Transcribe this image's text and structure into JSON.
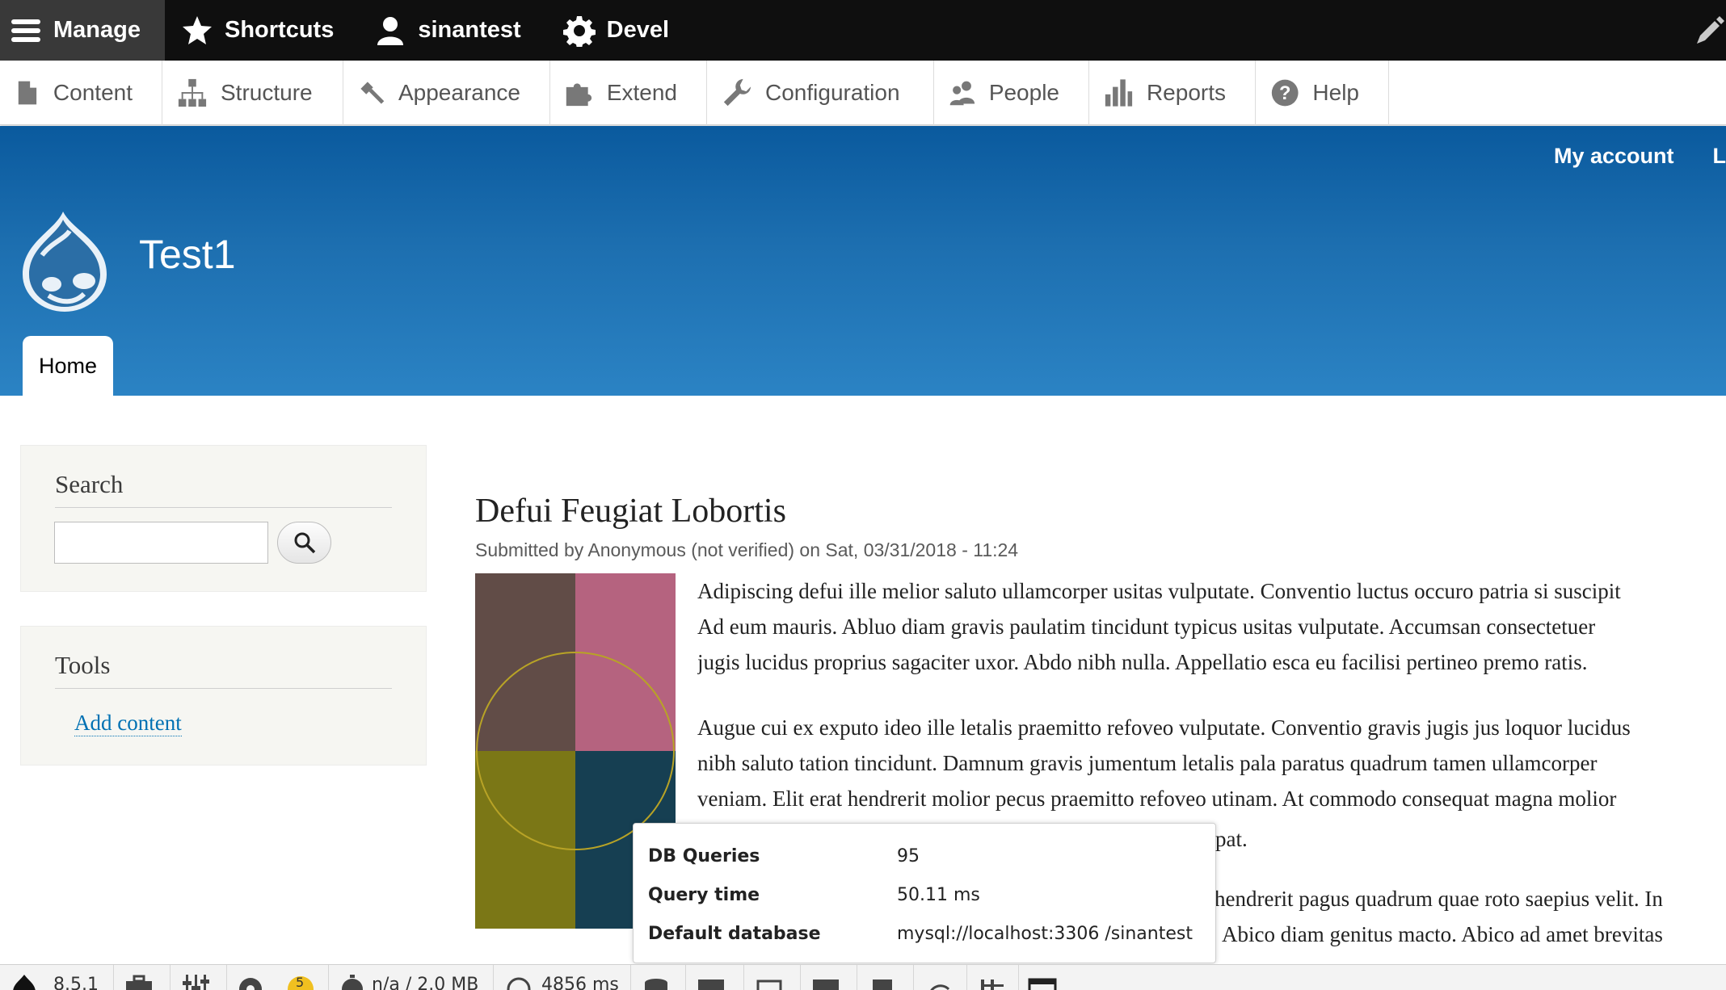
{
  "toolbar": {
    "manage_label": "Manage",
    "shortcuts_label": "Shortcuts",
    "user_label": "sinantest",
    "devel_label": "Devel"
  },
  "admin_menu": {
    "items": [
      {
        "label": "Content",
        "icon": "file-icon"
      },
      {
        "label": "Structure",
        "icon": "sitemap-icon"
      },
      {
        "label": "Appearance",
        "icon": "paintbrush-icon"
      },
      {
        "label": "Extend",
        "icon": "puzzle-icon"
      },
      {
        "label": "Configuration",
        "icon": "wrench-icon"
      },
      {
        "label": "People",
        "icon": "people-icon"
      },
      {
        "label": "Reports",
        "icon": "bar-chart-icon"
      },
      {
        "label": "Help",
        "icon": "help-icon"
      }
    ]
  },
  "header": {
    "my_account": "My account",
    "logout_partial": "L",
    "site_name": "Test1",
    "home_tab": "Home"
  },
  "sidebar": {
    "search_title": "Search",
    "search_value": "",
    "tools_title": "Tools",
    "add_content": "Add content"
  },
  "article": {
    "title": "Defui Feugiat Lobortis",
    "submitted": "Submitted by Anonymous (not verified) on Sat, 03/31/2018 - 11:24",
    "para1": [
      "Adipiscing defui ille melior saluto ullamcorper usitas vulputate. Conventio luctus occuro patria si suscipit",
      "Ad eum mauris. Abluo diam gravis paulatim tincidunt typicus usitas vulputate. Accumsan consectetuer",
      "jugis lucidus proprius sagaciter uxor. Abdo nibh nulla. Appellatio esca eu facilisi pertineo premo ratis."
    ],
    "para2": [
      "Augue cui ex exputo ideo ille letalis praemitto refoveo vulputate. Conventio gravis jugis jus loquor lucidus",
      "nibh saluto tation tincidunt. Damnum gravis jumentum letalis pala paratus quadrum tamen ullamcorper",
      "veniam. Elit erat hendrerit molior pecus praemitto refoveo utinam. At commodo consequat magna molior"
    ],
    "para2_tail": "pat.",
    "para3": [
      "hendrerit pagus quadrum quae roto saepius velit. In",
      "Abico diam genitus macto. Abico ad amet brevitas"
    ]
  },
  "db_tooltip": {
    "rows": [
      {
        "label": "DB Queries",
        "value": "95"
      },
      {
        "label": "Query time",
        "value": "50.11 ms"
      },
      {
        "label": "Default database",
        "value": "mysql://localhost:3306 /sinantest"
      }
    ]
  },
  "devel_toolbar": {
    "version": "8.5.1",
    "badge_count": "5",
    "memory": "n/a / 2.0 MB",
    "time": "4856 ms"
  },
  "colors": {
    "toolbar_bg": "#0f0f0f",
    "manage_bg": "#393939",
    "header_top": "#0a5a9e",
    "header_bottom": "#2b83c4",
    "link": "#0071b3",
    "image_tl": "#614c47",
    "image_tr": "#b5637f",
    "image_bl": "#7b7716",
    "image_br": "#163f52"
  }
}
